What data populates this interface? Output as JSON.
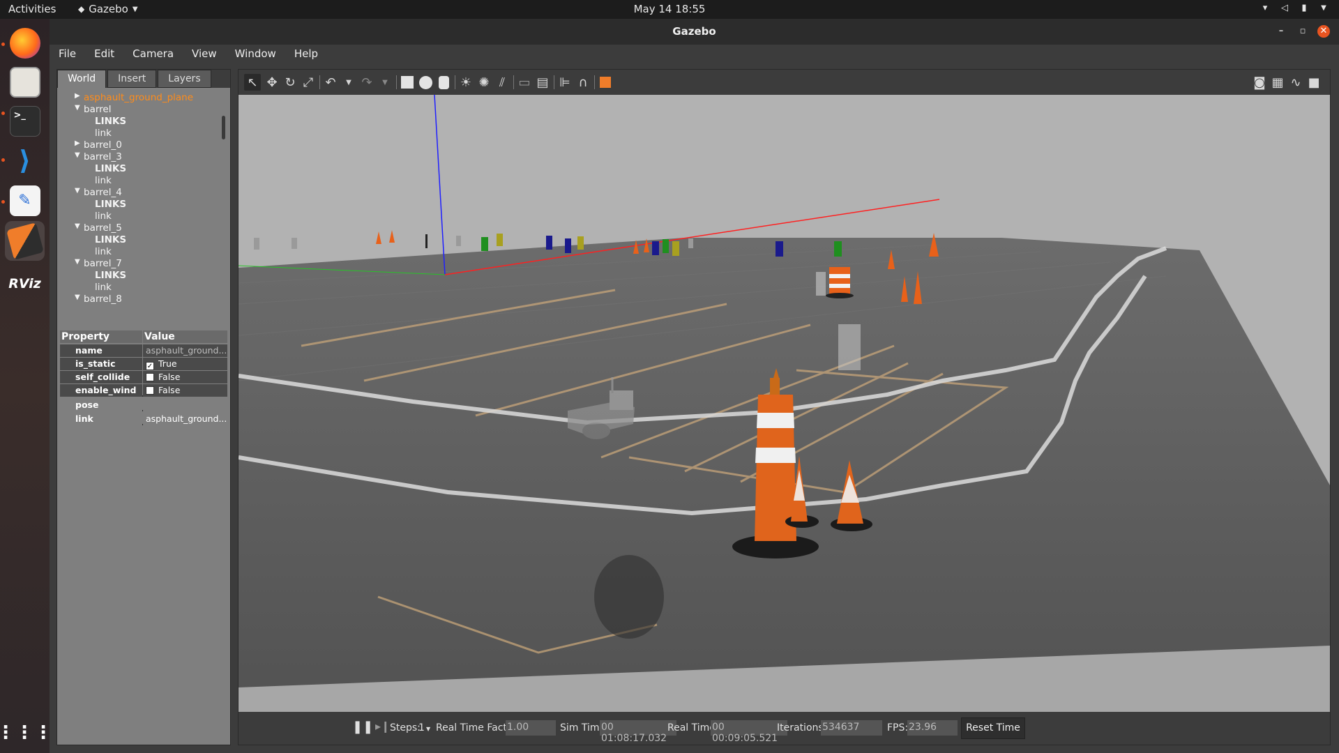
{
  "topbar": {
    "activities": "Activities",
    "app_menu": "Gazebo",
    "clock": "May 14  18:55"
  },
  "dock": {
    "items": [
      "firefox",
      "files",
      "terminal",
      "vscode",
      "text-editor",
      "gazebo",
      "rviz",
      "app-grid"
    ],
    "rviz_label": "RViz"
  },
  "window": {
    "title": "Gazebo",
    "menu": [
      "File",
      "Edit",
      "Camera",
      "View",
      "Window",
      "Help"
    ]
  },
  "left_panel": {
    "tabs": [
      "World",
      "Insert",
      "Layers"
    ],
    "tree": [
      {
        "label": "asphault_ground_plane",
        "arrow": "right",
        "selected": true
      },
      {
        "label": "barrel",
        "arrow": "down"
      },
      {
        "label": "LINKS",
        "child": true,
        "bold": true
      },
      {
        "label": "link",
        "child": true
      },
      {
        "label": "barrel_0",
        "arrow": "right"
      },
      {
        "label": "barrel_3",
        "arrow": "down"
      },
      {
        "label": "LINKS",
        "child": true,
        "bold": true
      },
      {
        "label": "link",
        "child": true
      },
      {
        "label": "barrel_4",
        "arrow": "down"
      },
      {
        "label": "LINKS",
        "child": true,
        "bold": true
      },
      {
        "label": "link",
        "child": true
      },
      {
        "label": "barrel_5",
        "arrow": "down"
      },
      {
        "label": "LINKS",
        "child": true,
        "bold": true
      },
      {
        "label": "link",
        "child": true
      },
      {
        "label": "barrel_7",
        "arrow": "down"
      },
      {
        "label": "LINKS",
        "child": true,
        "bold": true
      },
      {
        "label": "link",
        "child": true
      },
      {
        "label": "barrel_8",
        "arrow": "down"
      }
    ],
    "properties": {
      "header": {
        "property": "Property",
        "value": "Value"
      },
      "rows": [
        {
          "key": "name",
          "value": "asphault_ground..."
        },
        {
          "key": "is_static",
          "value": "True",
          "checked": true
        },
        {
          "key": "self_collide",
          "value": "False",
          "checked": false
        },
        {
          "key": "enable_wind",
          "value": "False",
          "checked": false
        },
        {
          "key": "pose",
          "value": ""
        },
        {
          "key": "link",
          "value": "asphault_ground..."
        }
      ]
    }
  },
  "bottom_bar": {
    "steps_label": "Steps:",
    "steps_value": "1",
    "rtf_label": "Real Time Factor:",
    "rtf_value": "1.00",
    "sim_time_label": "Sim Time:",
    "sim_time_value": "00 01:08:17.032",
    "real_time_label": "Real Time:",
    "real_time_value": "00 00:09:05.521",
    "iterations_label": "Iterations:",
    "iterations_value": "534637",
    "fps_label": "FPS:",
    "fps_value": "23.96",
    "reset_label": "Reset Time"
  },
  "colors": {
    "selection_orange": "#ff8c1a",
    "ubuntu_orange": "#e95420",
    "sky": "#b2b2b2",
    "ground": "#5c5c5c"
  }
}
